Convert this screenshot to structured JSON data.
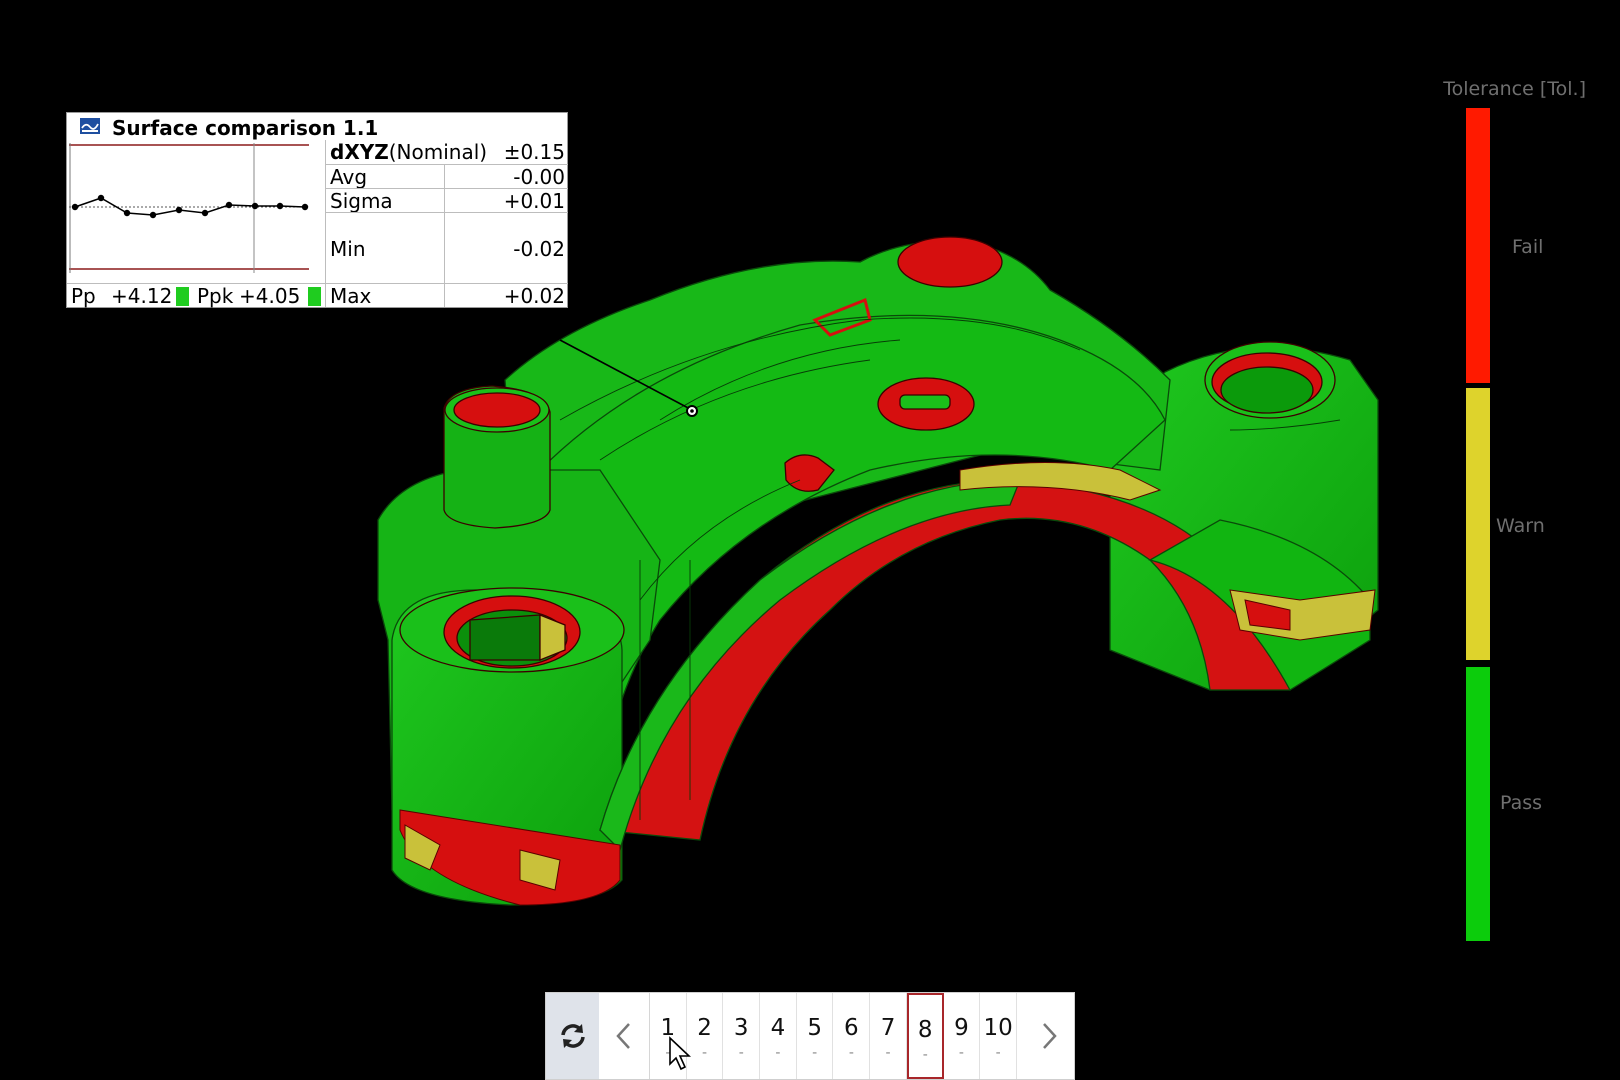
{
  "label": {
    "title": "Surface comparison 1.1",
    "pp_label": "Pp",
    "pp_value": "+4.12",
    "ppk_label": "Ppk",
    "ppk_value": "+4.05",
    "status_color": "#1fcc1f",
    "stats": {
      "measure_bold": "dXYZ",
      "measure_rest": "(Nominal)",
      "tolerance": "±0.15",
      "avg_label": "Avg",
      "avg": "-0.00",
      "sigma_label": "Sigma",
      "sigma": "+0.01",
      "min_label": "Min",
      "min": "-0.02",
      "max_label": "Max",
      "max": "+0.02"
    }
  },
  "legend": {
    "title": "Tolerance [Tol.]",
    "fail_label": "Fail",
    "warn_label": "Warn",
    "pass_label": "Pass",
    "fail_color": "#ff1a00",
    "warn_color": "#ded32c",
    "pass_color": "#0ccc0c"
  },
  "pager": {
    "pages": [
      {
        "num": "1",
        "sub": "-"
      },
      {
        "num": "2",
        "sub": "-"
      },
      {
        "num": "3",
        "sub": "-"
      },
      {
        "num": "4",
        "sub": "-"
      },
      {
        "num": "5",
        "sub": "-"
      },
      {
        "num": "6",
        "sub": "-"
      },
      {
        "num": "7",
        "sub": "-"
      },
      {
        "num": "8",
        "sub": "-"
      },
      {
        "num": "9",
        "sub": "-"
      },
      {
        "num": "10",
        "sub": "-"
      }
    ],
    "active_page": "8"
  },
  "model_colors": {
    "pass": "#11b811",
    "warn": "#c9c13a",
    "fail": "#d60f0f"
  }
}
